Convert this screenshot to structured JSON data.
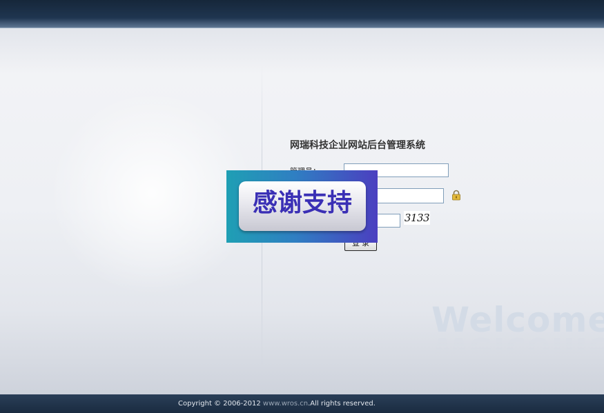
{
  "header": {},
  "login": {
    "title": "网瑞科技企业网站后台管理系统",
    "admin_label": "管理员：",
    "admin_value": "",
    "password_value": "",
    "captcha_value": "",
    "captcha_code": "3133",
    "login_button": "登 录"
  },
  "overlay": {
    "text": "感谢支持"
  },
  "decoration": {
    "welcome": "Welcome"
  },
  "footer": {
    "prefix": "Copyright © 2006-2012 ",
    "site": "www.wros.cn",
    "suffix": ".All rights reserved."
  },
  "icons": {
    "lock": "lock-icon"
  },
  "colors": {
    "header_dark": "#16273a",
    "overlay_blue": "#2f7fc2",
    "overlay_text": "#3a2fb5"
  }
}
